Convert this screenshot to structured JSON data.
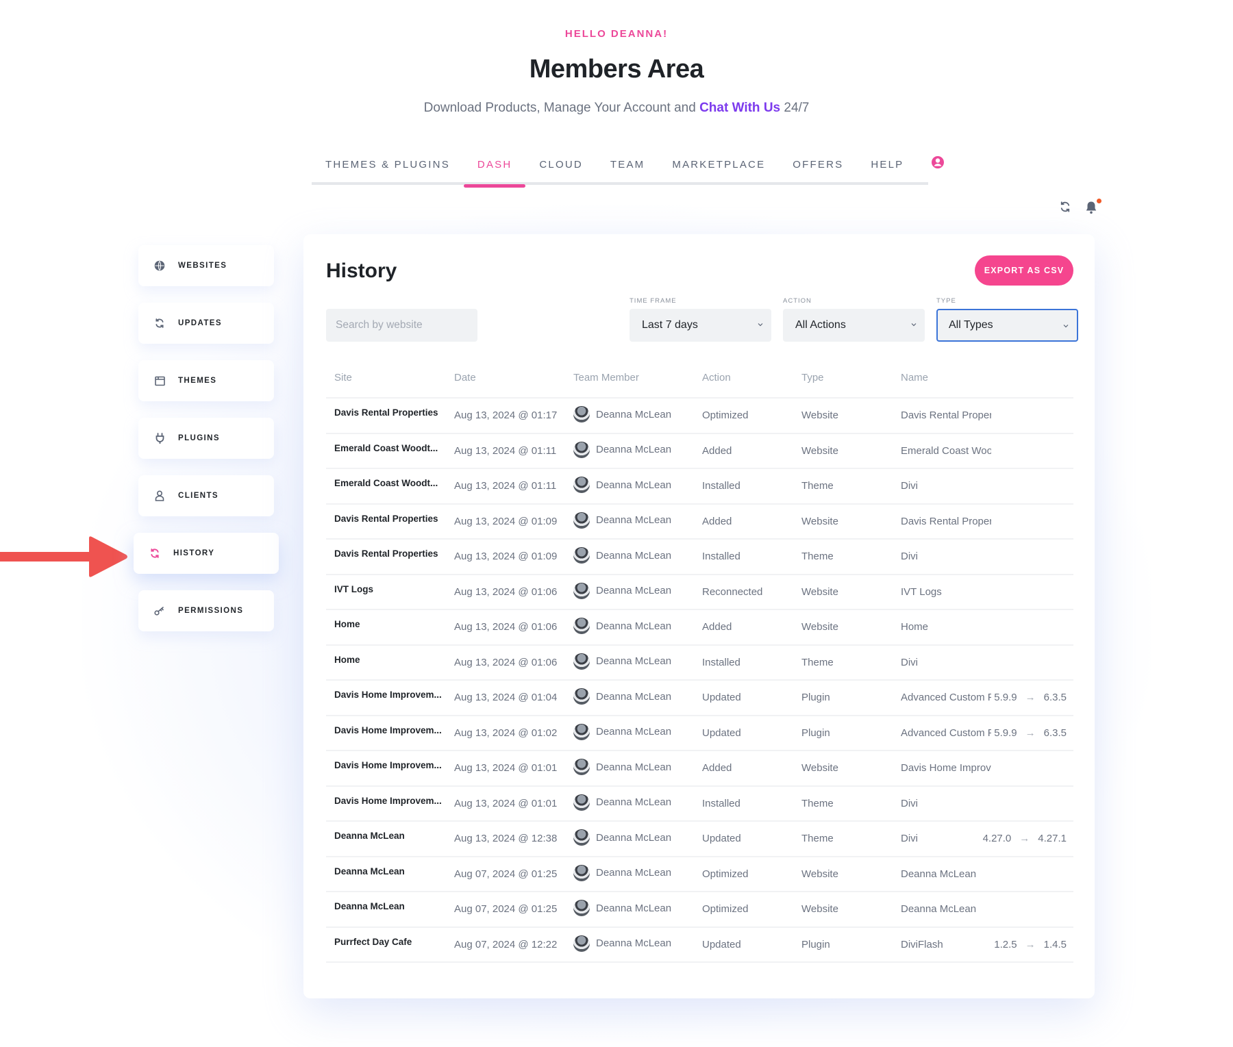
{
  "header": {
    "greeting": "HELLO DEANNA!",
    "title": "Members Area",
    "subtitle_prefix": "Download Products, Manage Your Account and ",
    "subtitle_link": "Chat With Us",
    "subtitle_suffix": " 24/7"
  },
  "nav": {
    "tabs": [
      {
        "label": "THEMES & PLUGINS",
        "active": false
      },
      {
        "label": "DASH",
        "active": true
      },
      {
        "label": "CLOUD",
        "active": false
      },
      {
        "label": "TEAM",
        "active": false
      },
      {
        "label": "MARKETPLACE",
        "active": false
      },
      {
        "label": "OFFERS",
        "active": false
      },
      {
        "label": "HELP",
        "active": false
      }
    ],
    "user_icon": "user-circle-icon"
  },
  "utility": {
    "refresh_icon": "refresh-icon",
    "bell_icon": "bell-icon",
    "has_notification": true
  },
  "sidebar": {
    "items": [
      {
        "label": "WEBSITES",
        "icon": "globe-icon",
        "active": false
      },
      {
        "label": "UPDATES",
        "icon": "refresh-icon",
        "active": false
      },
      {
        "label": "THEMES",
        "icon": "layout-icon",
        "active": false
      },
      {
        "label": "PLUGINS",
        "icon": "plug-icon",
        "active": false
      },
      {
        "label": "CLIENTS",
        "icon": "person-icon",
        "active": false
      },
      {
        "label": "HISTORY",
        "icon": "history-icon",
        "active": true
      },
      {
        "label": "PERMISSIONS",
        "icon": "key-icon",
        "active": false
      }
    ]
  },
  "history": {
    "title": "History",
    "export_label": "EXPORT AS CSV",
    "search_placeholder": "Search by website",
    "search_value": "",
    "filters": {
      "time_frame": {
        "label": "TIME FRAME",
        "value": "Last 7 days"
      },
      "action": {
        "label": "ACTION",
        "value": "All Actions"
      },
      "type": {
        "label": "TYPE",
        "value": "All Types"
      }
    },
    "columns": [
      "Site",
      "Date",
      "Team Member",
      "Action",
      "Type",
      "Name"
    ],
    "rows": [
      {
        "site": "Davis Rental Properties",
        "date": "Aug 13, 2024 @ 01:17",
        "member": "Deanna McLean",
        "action": "Optimized",
        "type": "Website",
        "name": "Davis Rental Proper",
        "from": "",
        "to": ""
      },
      {
        "site": "Emerald Coast Woodt...",
        "date": "Aug 13, 2024 @ 01:11",
        "member": "Deanna McLean",
        "action": "Added",
        "type": "Website",
        "name": "Emerald Coast Woo",
        "from": "",
        "to": ""
      },
      {
        "site": "Emerald Coast Woodt...",
        "date": "Aug 13, 2024 @ 01:11",
        "member": "Deanna McLean",
        "action": "Installed",
        "type": "Theme",
        "name": "Divi",
        "from": "",
        "to": ""
      },
      {
        "site": "Davis Rental Properties",
        "date": "Aug 13, 2024 @ 01:09",
        "member": "Deanna McLean",
        "action": "Added",
        "type": "Website",
        "name": "Davis Rental Proper",
        "from": "",
        "to": ""
      },
      {
        "site": "Davis Rental Properties",
        "date": "Aug 13, 2024 @ 01:09",
        "member": "Deanna McLean",
        "action": "Installed",
        "type": "Theme",
        "name": "Divi",
        "from": "",
        "to": ""
      },
      {
        "site": "IVT Logs",
        "date": "Aug 13, 2024 @ 01:06",
        "member": "Deanna McLean",
        "action": "Reconnected",
        "type": "Website",
        "name": "IVT Logs",
        "from": "",
        "to": ""
      },
      {
        "site": "Home",
        "date": "Aug 13, 2024 @ 01:06",
        "member": "Deanna McLean",
        "action": "Added",
        "type": "Website",
        "name": "Home",
        "from": "",
        "to": ""
      },
      {
        "site": "Home",
        "date": "Aug 13, 2024 @ 01:06",
        "member": "Deanna McLean",
        "action": "Installed",
        "type": "Theme",
        "name": "Divi",
        "from": "",
        "to": ""
      },
      {
        "site": "Davis Home Improvem...",
        "date": "Aug 13, 2024 @ 01:04",
        "member": "Deanna McLean",
        "action": "Updated",
        "type": "Plugin",
        "name": "Advanced Custom F",
        "from": "5.9.9",
        "to": "6.3.5"
      },
      {
        "site": "Davis Home Improvem...",
        "date": "Aug 13, 2024 @ 01:02",
        "member": "Deanna McLean",
        "action": "Updated",
        "type": "Plugin",
        "name": "Advanced Custom F",
        "from": "5.9.9",
        "to": "6.3.5"
      },
      {
        "site": "Davis Home Improvem...",
        "date": "Aug 13, 2024 @ 01:01",
        "member": "Deanna McLean",
        "action": "Added",
        "type": "Website",
        "name": "Davis Home Improv",
        "from": "",
        "to": ""
      },
      {
        "site": "Davis Home Improvem...",
        "date": "Aug 13, 2024 @ 01:01",
        "member": "Deanna McLean",
        "action": "Installed",
        "type": "Theme",
        "name": "Divi",
        "from": "",
        "to": ""
      },
      {
        "site": "Deanna McLean",
        "date": "Aug 13, 2024 @ 12:38",
        "member": "Deanna McLean",
        "action": "Updated",
        "type": "Theme",
        "name": "Divi",
        "from": "4.27.0",
        "to": "4.27.1"
      },
      {
        "site": "Deanna McLean",
        "date": "Aug 07, 2024 @ 01:25",
        "member": "Deanna McLean",
        "action": "Optimized",
        "type": "Website",
        "name": "Deanna McLean",
        "from": "",
        "to": ""
      },
      {
        "site": "Deanna McLean",
        "date": "Aug 07, 2024 @ 01:25",
        "member": "Deanna McLean",
        "action": "Optimized",
        "type": "Website",
        "name": "Deanna McLean",
        "from": "",
        "to": ""
      },
      {
        "site": "Purrfect Day Cafe",
        "date": "Aug 07, 2024 @ 12:22",
        "member": "Deanna McLean",
        "action": "Updated",
        "type": "Plugin",
        "name": "DiviFlash",
        "from": "1.2.5",
        "to": "1.4.5"
      }
    ]
  },
  "colors": {
    "accent_pink": "#ec4899",
    "export_pink": "#f5458e",
    "link_purple": "#7c3aed",
    "focus_blue": "#3b74d8",
    "annotation_arrow": "#ef5350",
    "notification_dot": "#f05a28"
  }
}
